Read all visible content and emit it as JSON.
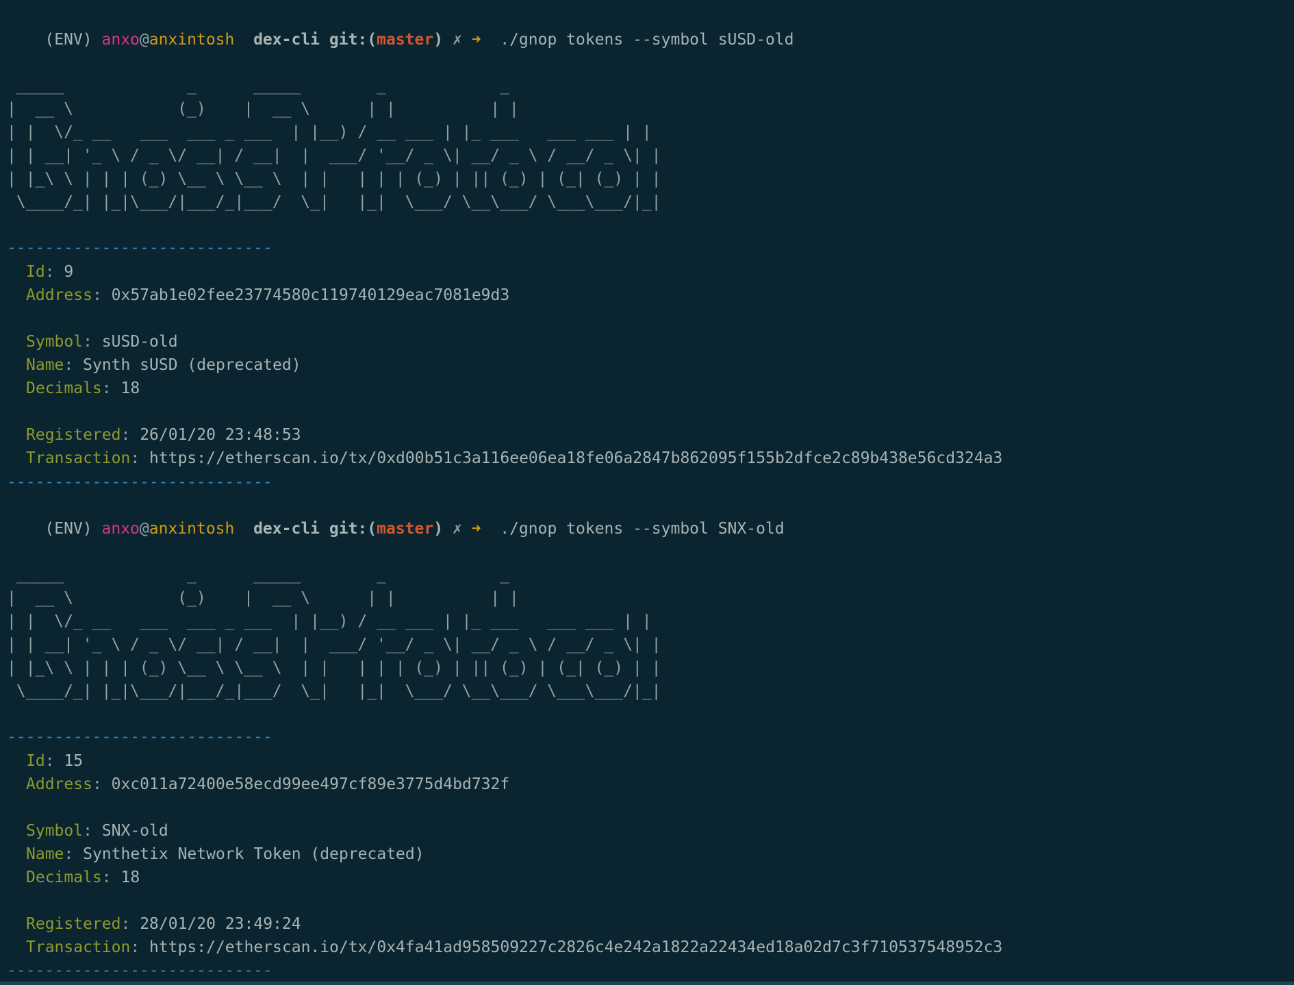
{
  "sessions": [
    {
      "prompt": {
        "env": "(ENV)",
        "user": "anxo",
        "at": "@",
        "host": "anxintosh",
        "dir": "dex-cli",
        "git_prefix": "git:(",
        "branch": "master",
        "git_suffix": ")",
        "dirty": "✗",
        "arrow": "➜",
        "command": "./gnop tokens --symbol sUSD-old"
      },
      "banner": " _____             _      _____        _            _ \n|  __ \\           (_)    |  __ \\      | |          | |\n| |  \\/_ __   ___  ___ _ ___  | |__) / __ ___ | |_ ___   ___ ___ | |\n| | __| '_ \\ / _ \\/ __| / __|  |  ___/ '__/ _ \\| __/ _ \\ / __/ _ \\| |\n| |_\\ \\ | | | (_) \\__ \\ \\__ \\  | |   | | | (_) | || (_) | (_| (_) | |\n \\____/_| |_|\\___/|___/_|___/  \\_|   |_|  \\___/ \\__\\___/ \\___\\___/|_|",
      "rule": "----------------------------",
      "fields": {
        "id_label": "Id",
        "id": "9",
        "address_label": "Address",
        "address": "0x57ab1e02fee23774580c119740129eac7081e9d3",
        "symbol_label": "Symbol",
        "symbol": "sUSD-old",
        "name_label": "Name",
        "name": "Synth sUSD (deprecated)",
        "decimals_label": "Decimals",
        "decimals": "18",
        "registered_label": "Registered",
        "registered": "26/01/20 23:48:53",
        "transaction_label": "Transaction",
        "transaction": "https://etherscan.io/tx/0xd00b51c3a116ee06ea18fe06a2847b862095f155b2dfce2c89b438e56cd324a3"
      }
    },
    {
      "prompt": {
        "env": "(ENV)",
        "user": "anxo",
        "at": "@",
        "host": "anxintosh",
        "dir": "dex-cli",
        "git_prefix": "git:(",
        "branch": "master",
        "git_suffix": ")",
        "dirty": "✗",
        "arrow": "➜",
        "command": "./gnop tokens --symbol SNX-old"
      },
      "banner": " _____             _      _____        _            _ \n|  __ \\           (_)    |  __ \\      | |          | |\n| |  \\/_ __   ___  ___ _ ___  | |__) / __ ___ | |_ ___   ___ ___ | |\n| | __| '_ \\ / _ \\/ __| / __|  |  ___/ '__/ _ \\| __/ _ \\ / __/ _ \\| |\n| |_\\ \\ | | | (_) \\__ \\ \\__ \\  | |   | | | (_) | || (_) | (_| (_) | |\n \\____/_| |_|\\___/|___/_|___/  \\_|   |_|  \\___/ \\__\\___/ \\___\\___/|_|",
      "rule": "----------------------------",
      "fields": {
        "id_label": "Id",
        "id": "15",
        "address_label": "Address",
        "address": "0xc011a72400e58ecd99ee497cf89e3775d4bd732f",
        "symbol_label": "Symbol",
        "symbol": "SNX-old",
        "name_label": "Name",
        "name": "Synthetix Network Token (deprecated)",
        "decimals_label": "Decimals",
        "decimals": "18",
        "registered_label": "Registered",
        "registered": "28/01/20 23:49:24",
        "transaction_label": "Transaction",
        "transaction": "https://etherscan.io/tx/0x4fa41ad958509227c2826c4e242a1822a22434ed18a02d7c3f710537548952c3"
      }
    }
  ]
}
